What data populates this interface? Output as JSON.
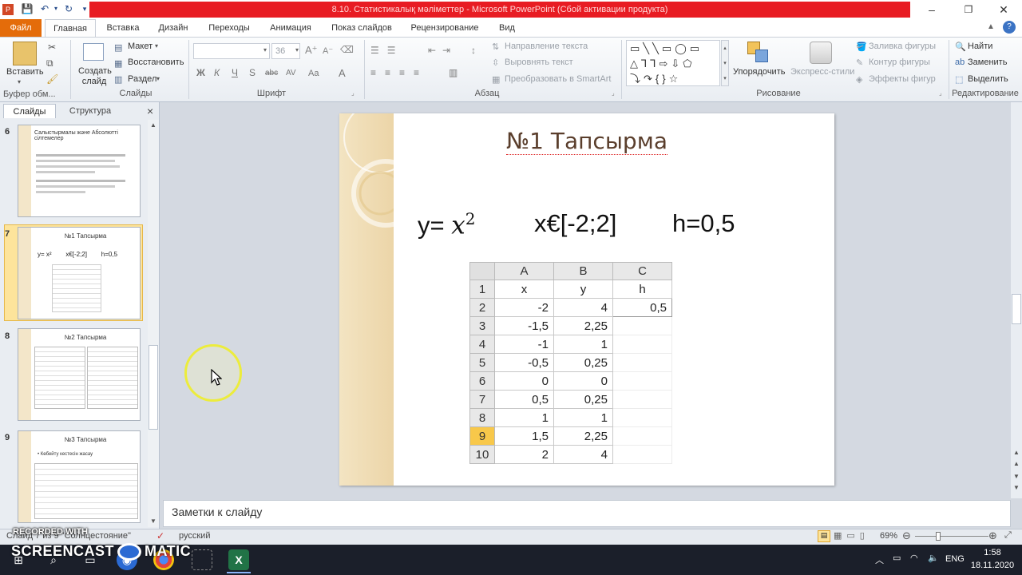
{
  "window": {
    "title": "8.10. Статистикалық мәліметтер  -  Microsoft PowerPoint (Сбой активации продукта)",
    "controls": {
      "minimize": "–",
      "maximize": "❐",
      "close": "✕"
    }
  },
  "tabs": [
    {
      "label": "Файл"
    },
    {
      "label": "Главная"
    },
    {
      "label": "Вставка"
    },
    {
      "label": "Дизайн"
    },
    {
      "label": "Переходы"
    },
    {
      "label": "Анимация"
    },
    {
      "label": "Показ слайдов"
    },
    {
      "label": "Рецензирование"
    },
    {
      "label": "Вид"
    }
  ],
  "ribbon": {
    "clipboard": {
      "paste": "Вставить",
      "group": "Буфер обм..."
    },
    "slides": {
      "new_slide": "Создать слайд",
      "layout": "Макет",
      "reset": "Восстановить",
      "section": "Раздел",
      "group": "Слайды"
    },
    "font": {
      "size": "36",
      "bold": "Ж",
      "italic": "К",
      "underline": "Ч",
      "strike": "S",
      "abc": "abc",
      "spacing": "AV",
      "case": "Aa",
      "color": "A",
      "group": "Шрифт"
    },
    "paragraph": {
      "direction": "Направление текста",
      "align": "Выровнять текст",
      "smartart": "Преобразовать в SmartArt",
      "group": "Абзац"
    },
    "drawing": {
      "arrange": "Упорядочить",
      "styles": "Экспресс-стили",
      "fill": "Заливка фигуры",
      "outline": "Контур фигуры",
      "effects": "Эффекты фигур",
      "group": "Рисование"
    },
    "editing": {
      "find": "Найти",
      "replace": "Заменить",
      "select": "Выделить",
      "group": "Редактирование"
    }
  },
  "left_pane": {
    "tab_slides": "Слайды",
    "tab_outline": "Структура",
    "close": "×",
    "thumbs": [
      {
        "num": "6",
        "title": "Салыстырмалы және Абсолютті сілтемелер"
      },
      {
        "num": "7",
        "title": "№1 Тапсырма",
        "formula": "y= x²        x€[-2;2]        h=0,5"
      },
      {
        "num": "8",
        "title": "№2 Тапсырма"
      },
      {
        "num": "9",
        "title": "№3 Тапсырма",
        "bullet": "• Көбейту кестесін жасау"
      }
    ]
  },
  "slide": {
    "title": "№1 Тапсырма",
    "formula_y": "y=",
    "formula_x": "x",
    "formula_exp": "2",
    "domain": "x€[-2;2]",
    "step": "h=0,5",
    "sheet": {
      "col_headers": [
        "A",
        "B",
        "C"
      ],
      "rows": [
        {
          "n": "1",
          "a": "x",
          "b": "y",
          "c": "h"
        },
        {
          "n": "2",
          "a": "-2",
          "b": "4",
          "c": "0,5"
        },
        {
          "n": "3",
          "a": "-1,5",
          "b": "2,25",
          "c": ""
        },
        {
          "n": "4",
          "a": "-1",
          "b": "1",
          "c": ""
        },
        {
          "n": "5",
          "a": "-0,5",
          "b": "0,25",
          "c": ""
        },
        {
          "n": "6",
          "a": "0",
          "b": "0",
          "c": ""
        },
        {
          "n": "7",
          "a": "0,5",
          "b": "0,25",
          "c": ""
        },
        {
          "n": "8",
          "a": "1",
          "b": "1",
          "c": ""
        },
        {
          "n": "9",
          "a": "1,5",
          "b": "2,25",
          "c": ""
        },
        {
          "n": "10",
          "a": "2",
          "b": "4",
          "c": ""
        }
      ]
    }
  },
  "notes": {
    "placeholder": "Заметки к слайду"
  },
  "status": {
    "slide_info": "Слайд 7 из 9   \"Солнцестояние\"",
    "language": "русский",
    "zoom": "69%"
  },
  "overlay": {
    "recorded_with": "RECORDED WITH",
    "brand1": "SCREENCAST",
    "brand2": "MATIC"
  },
  "taskbar": {
    "lang": "ENG",
    "time": "1:58",
    "date": "18.11.2020"
  },
  "colors": {
    "accent_file": "#e46c0a",
    "title_bar": "#e81c23",
    "selected_row": "#f8c84a"
  }
}
